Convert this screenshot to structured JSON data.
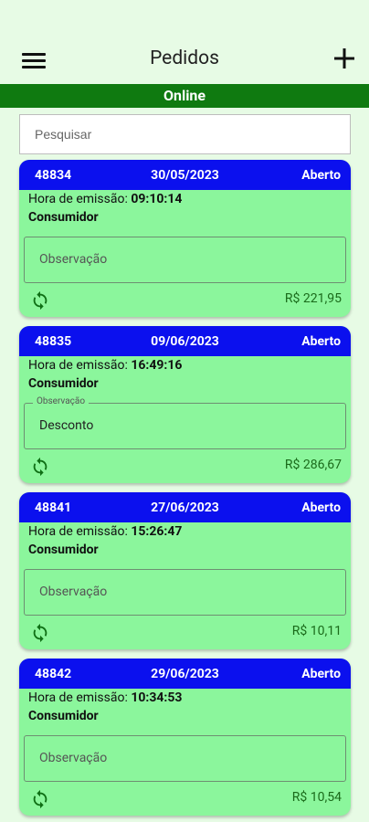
{
  "header": {
    "title": "Pedidos"
  },
  "status": {
    "label": "Online",
    "color": "#0f7a10"
  },
  "search": {
    "placeholder": "Pesquisar"
  },
  "cards": [
    {
      "number": "48834",
      "date": "30/05/2023",
      "state": "Aberto",
      "time_label": "Hora de emissão: ",
      "time": "09:10:14",
      "customer": "Consumidor",
      "obs_placeholder": "Observação",
      "obs_label": "",
      "obs_value": "",
      "total": "R$ 221,95"
    },
    {
      "number": "48835",
      "date": "09/06/2023",
      "state": "Aberto",
      "time_label": "Hora de emissão: ",
      "time": "16:49:16",
      "customer": "Consumidor",
      "obs_placeholder": "",
      "obs_label": "Observação",
      "obs_value": "Desconto",
      "total": "R$ 286,67"
    },
    {
      "number": "48841",
      "date": "27/06/2023",
      "state": "Aberto",
      "time_label": "Hora de emissão: ",
      "time": "15:26:47",
      "customer": "Consumidor",
      "obs_placeholder": "Observação",
      "obs_label": "",
      "obs_value": "",
      "total": "R$ 10,11"
    },
    {
      "number": "48842",
      "date": "29/06/2023",
      "state": "Aberto",
      "time_label": "Hora de emissão: ",
      "time": "10:34:53",
      "customer": "Consumidor",
      "obs_placeholder": "Observação",
      "obs_label": "",
      "obs_value": "",
      "total": "R$ 10,54"
    }
  ]
}
